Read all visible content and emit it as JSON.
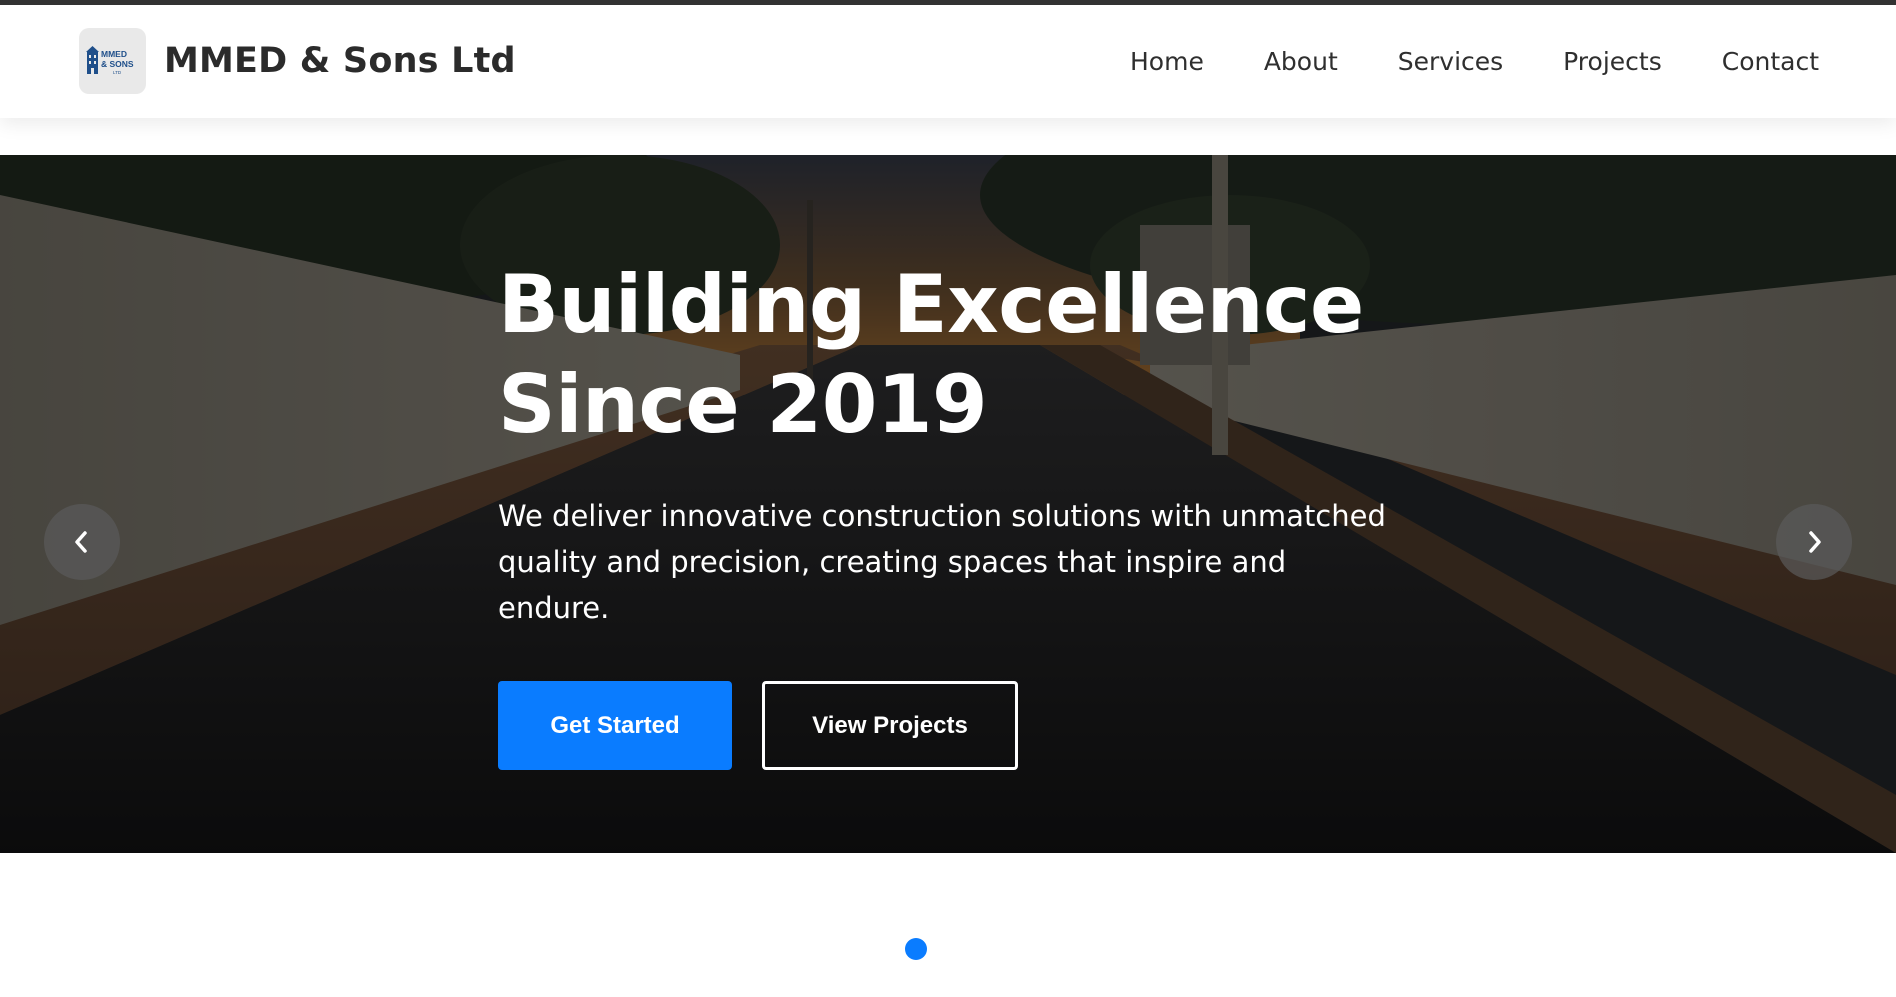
{
  "brand": {
    "name": "MMED & Sons Ltd",
    "logo_text_1": "MMED",
    "logo_text_2": "& SONS",
    "logo_text_3": "LTD"
  },
  "nav": {
    "items": [
      {
        "label": "Home"
      },
      {
        "label": "About"
      },
      {
        "label": "Services"
      },
      {
        "label": "Projects"
      },
      {
        "label": "Contact"
      }
    ]
  },
  "hero": {
    "title_line_1": "Building Excellence",
    "title_line_2": "Since 2019",
    "subtitle": "We deliver innovative construction solutions with unmatched quality and precision, creating spaces that inspire and endure.",
    "primary_button": "Get Started",
    "secondary_button": "View Projects"
  },
  "carousel": {
    "prev_icon": "chevron-left-icon",
    "next_icon": "chevron-right-icon",
    "slide_count": 1,
    "active_index": 0
  },
  "colors": {
    "accent": "#0a7cff",
    "text_dark": "#2b2b2b",
    "top_strip": "#333333"
  }
}
